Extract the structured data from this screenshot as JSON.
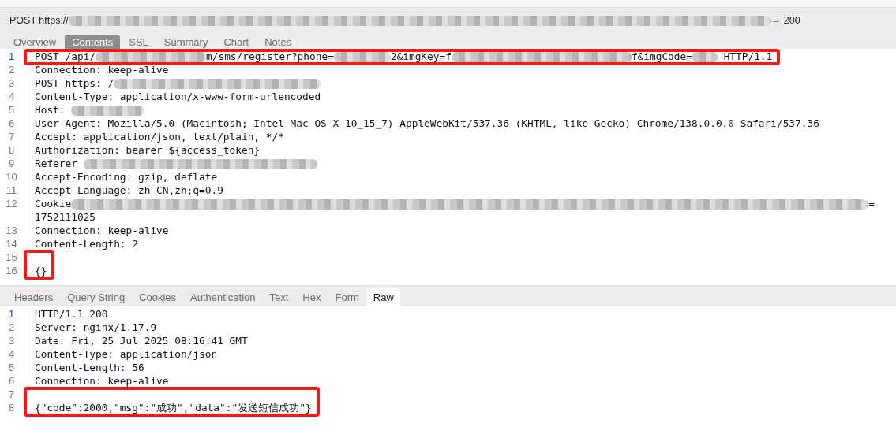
{
  "title": {
    "segments": [
      {
        "kind": "text",
        "text": "POST https://"
      },
      {
        "kind": "redacted"
      },
      {
        "kind": "text",
        "text": "→ 200"
      }
    ]
  },
  "request_tabs": [
    {
      "label": "Overview",
      "selected": false
    },
    {
      "label": "Contents",
      "selected": true
    },
    {
      "label": "SSL",
      "selected": false
    },
    {
      "label": "Summary",
      "selected": false
    },
    {
      "label": "Chart",
      "selected": false
    },
    {
      "label": "Notes",
      "selected": false
    }
  ],
  "request": {
    "blocks": [
      {
        "highlighted": true,
        "lines": [
          {
            "number": "1",
            "current": true,
            "segments": [
              {
                "kind": "text",
                "text": "POST /api/"
              },
              {
                "kind": "redacted"
              },
              {
                "kind": "text",
                "text": "m/sms/register?phone="
              },
              {
                "kind": "redacted"
              },
              {
                "kind": "text",
                "text": "2&imgKey=f"
              },
              {
                "kind": "redacted"
              },
              {
                "kind": "text",
                "text": "f&imgCode="
              },
              {
                "kind": "redacted"
              },
              {
                "kind": "text",
                "text": " HTTP/1.1"
              }
            ]
          }
        ]
      },
      {
        "highlighted": false,
        "lines": [
          {
            "number": "2",
            "current": false,
            "segments": [
              {
                "kind": "text",
                "text": "Connection: keep-alive"
              }
            ]
          },
          {
            "number": "3",
            "current": false,
            "segments": [
              {
                "kind": "text",
                "text": "POST https: /"
              },
              {
                "kind": "redacted"
              }
            ]
          },
          {
            "number": "4",
            "current": false,
            "segments": [
              {
                "kind": "text",
                "text": "Content-Type: application/x-www-form-urlencoded"
              }
            ]
          },
          {
            "number": "5",
            "current": false,
            "segments": [
              {
                "kind": "text",
                "text": "Host: "
              },
              {
                "kind": "redacted"
              }
            ]
          },
          {
            "number": "6",
            "current": false,
            "segments": [
              {
                "kind": "text",
                "text": "User-Agent: Mozilla/5.0 (Macintosh; Intel Mac OS X 10_15_7) AppleWebKit/537.36 (KHTML, like Gecko) Chrome/138.0.0.0 Safari/537.36"
              }
            ]
          },
          {
            "number": "7",
            "current": false,
            "segments": [
              {
                "kind": "text",
                "text": "Accept: application/json, text/plain, */*"
              }
            ]
          },
          {
            "number": "8",
            "current": false,
            "segments": [
              {
                "kind": "text",
                "text": "Authorization: bearer ${access_token}"
              }
            ]
          },
          {
            "number": "9",
            "current": false,
            "segments": [
              {
                "kind": "text",
                "text": "Referer "
              },
              {
                "kind": "redacted"
              }
            ]
          },
          {
            "number": "10",
            "current": false,
            "segments": [
              {
                "kind": "text",
                "text": "Accept-Encoding: gzip, deflate"
              }
            ]
          },
          {
            "number": "11",
            "current": false,
            "segments": [
              {
                "kind": "text",
                "text": "Accept-Language: zh-CN,zh;q=0.9"
              }
            ]
          },
          {
            "number": "12",
            "current": false,
            "segments": [
              {
                "kind": "text",
                "text": "Cookie"
              },
              {
                "kind": "redacted"
              },
              {
                "kind": "text",
                "text": "="
              }
            ]
          },
          {
            "segments": [
              {
                "kind": "text",
                "text": "1752111025"
              }
            ]
          },
          {
            "number": "13",
            "current": false,
            "segments": [
              {
                "kind": "text",
                "text": "Connection: keep-alive"
              }
            ]
          },
          {
            "number": "14",
            "current": false,
            "segments": [
              {
                "kind": "text",
                "text": "Content-Length: 2"
              }
            ]
          }
        ]
      },
      {
        "highlighted": true,
        "lines": [
          {
            "number": "15",
            "current": false
          },
          {
            "number": "16",
            "current": false,
            "segments": [
              {
                "kind": "text",
                "text": "{}"
              }
            ]
          }
        ]
      }
    ]
  },
  "response_tabs": [
    {
      "label": "Headers",
      "selected": false
    },
    {
      "label": "Query String",
      "selected": false
    },
    {
      "label": "Cookies",
      "selected": false
    },
    {
      "label": "Authentication",
      "selected": false
    },
    {
      "label": "Text",
      "selected": false
    },
    {
      "label": "Hex",
      "selected": false
    },
    {
      "label": "Form",
      "selected": false
    },
    {
      "label": "Raw",
      "selected": true
    }
  ],
  "response": {
    "blocks": [
      {
        "highlighted": false,
        "lines": [
          {
            "number": "1",
            "current": true,
            "segments": [
              {
                "kind": "text",
                "text": "HTTP/1.1 200"
              }
            ]
          },
          {
            "number": "2",
            "current": false,
            "segments": [
              {
                "kind": "text",
                "text": "Server: nginx/1.17.9"
              }
            ]
          },
          {
            "number": "3",
            "current": false,
            "segments": [
              {
                "kind": "text",
                "text": "Date: Fri, 25 Jul 2025 08:16:41 GMT"
              }
            ]
          },
          {
            "number": "4",
            "current": false,
            "segments": [
              {
                "kind": "text",
                "text": "Content-Type: application/json"
              }
            ]
          },
          {
            "number": "5",
            "current": false,
            "segments": [
              {
                "kind": "text",
                "text": "Content-Length: 56"
              }
            ]
          },
          {
            "number": "6",
            "current": false,
            "segments": [
              {
                "kind": "text",
                "text": "Connection: keep-alive"
              }
            ]
          }
        ]
      },
      {
        "highlighted": true,
        "lines": [
          {
            "number": "7",
            "current": false
          },
          {
            "number": "8",
            "current": false,
            "segments": [
              {
                "kind": "text",
                "text": "{\"code\":2000,\"msg\":\"成功\",\"data\":\"发送短信成功\"}"
              }
            ]
          }
        ]
      }
    ]
  }
}
